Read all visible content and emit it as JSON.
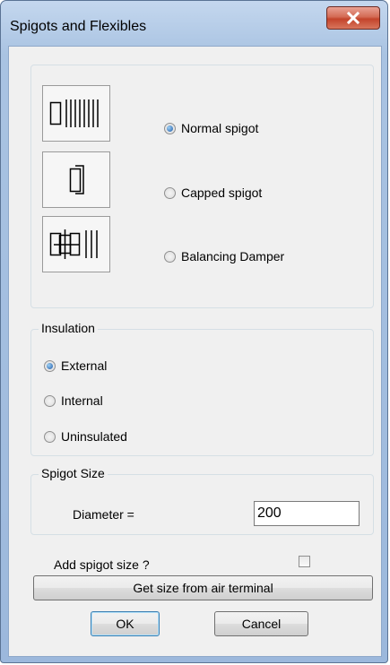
{
  "window": {
    "title": "Spigots and Flexibles"
  },
  "spigot_type": {
    "options": [
      {
        "label": "Normal spigot",
        "checked": true
      },
      {
        "label": "Capped spigot",
        "checked": false
      },
      {
        "label": "Balancing Damper",
        "checked": false
      }
    ]
  },
  "insulation": {
    "label": "Insulation",
    "options": [
      {
        "label": "External",
        "checked": true
      },
      {
        "label": "Internal",
        "checked": false
      },
      {
        "label": "Uninsulated",
        "checked": false
      }
    ]
  },
  "spigot_size": {
    "label": "Spigot Size",
    "diameter_label": "Diameter =",
    "diameter_value": "200"
  },
  "add_size": {
    "label": "Add spigot size ?",
    "checked": false
  },
  "buttons": {
    "get_size": "Get size from air terminal",
    "ok": "OK",
    "cancel": "Cancel"
  }
}
